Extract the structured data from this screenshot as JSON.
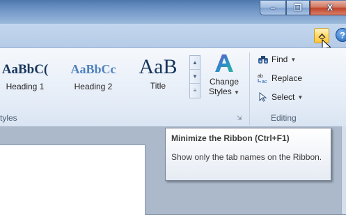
{
  "window": {
    "controls": {
      "minimize": "–",
      "maximize": "❐",
      "close": "X"
    }
  },
  "ribbon_controls": {
    "minimize_ribbon_icon": "chevron-up-icon",
    "help_label": "?"
  },
  "styles_group": {
    "label": "tyles",
    "items": [
      {
        "preview": "AaBbC(",
        "label": "Heading 1"
      },
      {
        "preview": "AaBbCc",
        "label": "Heading 2"
      },
      {
        "preview": "AaB",
        "label": "Title"
      }
    ],
    "change_styles": {
      "line1": "Change",
      "line2": "Styles"
    }
  },
  "editing_group": {
    "label": "Editing",
    "find": "Find",
    "replace": "Replace",
    "select": "Select"
  },
  "tooltip": {
    "title": "Minimize the Ribbon (Ctrl+F1)",
    "body": "Show only the tab names on the Ribbon."
  },
  "colors": {
    "accent": "#ffc83b",
    "title_bar": "#4e78ad",
    "ribbon": "#e4ecf7"
  }
}
